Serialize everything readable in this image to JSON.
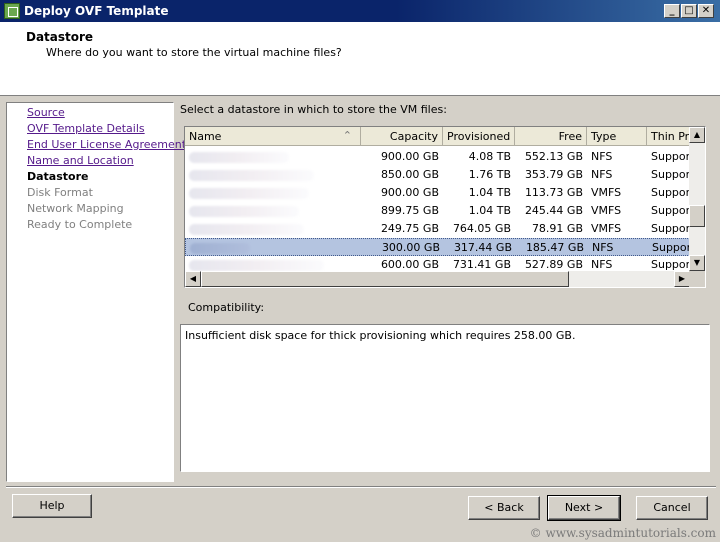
{
  "window": {
    "title": "Deploy OVF Template",
    "controls": {
      "minimize": "_",
      "maximize": "□",
      "close": "✕"
    }
  },
  "header": {
    "title": "Datastore",
    "subtitle": "Where do you want to store the virtual machine files?"
  },
  "steps": [
    {
      "label": "Source",
      "state": "link"
    },
    {
      "label": "OVF Template Details",
      "state": "link"
    },
    {
      "label": "End User License Agreement",
      "state": "link"
    },
    {
      "label": "Name and Location",
      "state": "link"
    },
    {
      "label": "Datastore",
      "state": "current"
    },
    {
      "label": "Disk Format",
      "state": "future"
    },
    {
      "label": "Network Mapping",
      "state": "future"
    },
    {
      "label": "Ready to Complete",
      "state": "future"
    }
  ],
  "main": {
    "instruction": "Select a datastore in which to store the VM files:",
    "table": {
      "columns": [
        "Name",
        "Capacity",
        "Provisioned",
        "Free",
        "Type",
        "Thin Pro"
      ],
      "sort_icon": "sort-arrow-icon",
      "rows": [
        {
          "capacity": "900.00 GB",
          "provisioned": "4.08 TB",
          "free": "552.13 GB",
          "type": "NFS",
          "thin": "Support",
          "selected": false
        },
        {
          "capacity": "850.00 GB",
          "provisioned": "1.76 TB",
          "free": "353.79 GB",
          "type": "NFS",
          "thin": "Support",
          "selected": false
        },
        {
          "capacity": "900.00 GB",
          "provisioned": "1.04 TB",
          "free": "113.73 GB",
          "type": "VMFS",
          "thin": "Support",
          "selected": false
        },
        {
          "capacity": "899.75 GB",
          "provisioned": "1.04 TB",
          "free": "245.44 GB",
          "type": "VMFS",
          "thin": "Support",
          "selected": false
        },
        {
          "capacity": "249.75 GB",
          "provisioned": "764.05 GB",
          "free": "78.91 GB",
          "type": "VMFS",
          "thin": "Support",
          "selected": false
        },
        {
          "capacity": "300.00 GB",
          "provisioned": "317.44 GB",
          "free": "185.47 GB",
          "type": "NFS",
          "thin": "Support",
          "selected": true
        },
        {
          "capacity": "600.00 GB",
          "provisioned": "731.41 GB",
          "free": "527.89 GB",
          "type": "NFS",
          "thin": "Support",
          "selected": false
        }
      ]
    },
    "compatibility_label": "Compatibility:",
    "compatibility_message": "Insufficient disk space for thick provisioning which requires 258.00 GB."
  },
  "buttons": {
    "help": "Help",
    "back": "< Back",
    "next": "Next >",
    "cancel": "Cancel"
  },
  "watermark": "© www.sysadmintutorials.com"
}
